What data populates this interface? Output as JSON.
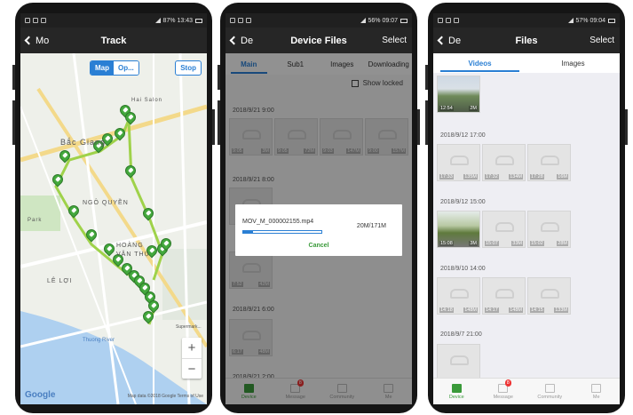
{
  "colors": {
    "accent": "#2a7fd4",
    "green": "#3a9a3a",
    "route": "#9fd24a",
    "pin": "#43a83c"
  },
  "phone1": {
    "status": {
      "right": "87% 13:43"
    },
    "nav": {
      "back": "Mo",
      "title": "Track"
    },
    "segmented": {
      "map": "Map",
      "other": "Op..."
    },
    "stop": "Stop",
    "map_labels": [
      "Hai Salon",
      "Bắc Giang",
      "NGÔ QUYỀN",
      "Park",
      "HOÀNG VĂN THỤ",
      "LÊ LỢI",
      "Supermark...",
      "Thuong River"
    ],
    "zoom_in": "+",
    "zoom_out": "−",
    "google": "Google",
    "map_note": "Map data ©2018 Google   Terms of Use"
  },
  "phone2": {
    "status": {
      "right": "56% 09:07"
    },
    "nav": {
      "back": "De",
      "title": "Device Files",
      "select": "Select"
    },
    "tabs": [
      "Main",
      "Sub1",
      "Images",
      "Downloading"
    ],
    "show_locked": "Show locked",
    "groups": [
      {
        "date": "2018/9/21 9:00",
        "items": [
          {
            "t": "9:05",
            "s": "3M"
          },
          {
            "t": "9:05",
            "s": "72M"
          },
          {
            "t": "9:03",
            "s": "147M"
          },
          {
            "t": "9:00",
            "s": "157M"
          }
        ]
      },
      {
        "date": "2018/9/21 8:00",
        "items": [
          {
            "t": "",
            "s": ""
          }
        ]
      },
      {
        "date": "",
        "items": [
          {
            "t": "7:52",
            "s": "42M"
          }
        ]
      },
      {
        "date": "2018/9/21 6:00",
        "items": [
          {
            "t": "6:17",
            "s": "48M"
          }
        ]
      },
      {
        "date": "2018/9/21 2:00",
        "items": []
      }
    ],
    "dialog": {
      "filename": "MOV_M_000002155.mp4",
      "size": "20M/171M",
      "progress": 0.12,
      "cancel": "Cancel"
    },
    "tabbar": [
      {
        "label": "Device"
      },
      {
        "label": "Message",
        "badge": "8"
      },
      {
        "label": "Community"
      },
      {
        "label": "Me"
      }
    ]
  },
  "phone3": {
    "status": {
      "right": "57% 09:04"
    },
    "nav": {
      "back": "De",
      "title": "Files",
      "select": "Select"
    },
    "tabs": [
      "Videos",
      "Images"
    ],
    "groups": [
      {
        "date": "",
        "items": [
          {
            "t": "12:54",
            "s": "2M",
            "photo": "1"
          }
        ]
      },
      {
        "date": "2018/9/12 17:00",
        "items": [
          {
            "t": "17:33",
            "s": "135M"
          },
          {
            "t": "17:32",
            "s": "134M"
          },
          {
            "t": "17:28",
            "s": "16M"
          }
        ]
      },
      {
        "date": "2018/9/12 15:00",
        "items": [
          {
            "t": "15:08",
            "s": "3M",
            "photo": "2"
          },
          {
            "t": "15:07",
            "s": "33M"
          },
          {
            "t": "15:02",
            "s": "28M"
          }
        ]
      },
      {
        "date": "2018/9/10 14:00",
        "items": [
          {
            "t": "14:18",
            "s": "148M"
          },
          {
            "t": "14:17",
            "s": "148M"
          },
          {
            "t": "14:15",
            "s": "133M"
          }
        ]
      },
      {
        "date": "2018/9/7 21:00",
        "items": [
          {
            "t": "",
            "s": ""
          }
        ]
      }
    ],
    "tabbar": [
      {
        "label": "Device"
      },
      {
        "label": "Message",
        "badge": "8"
      },
      {
        "label": "Community"
      },
      {
        "label": "Me"
      }
    ]
  }
}
